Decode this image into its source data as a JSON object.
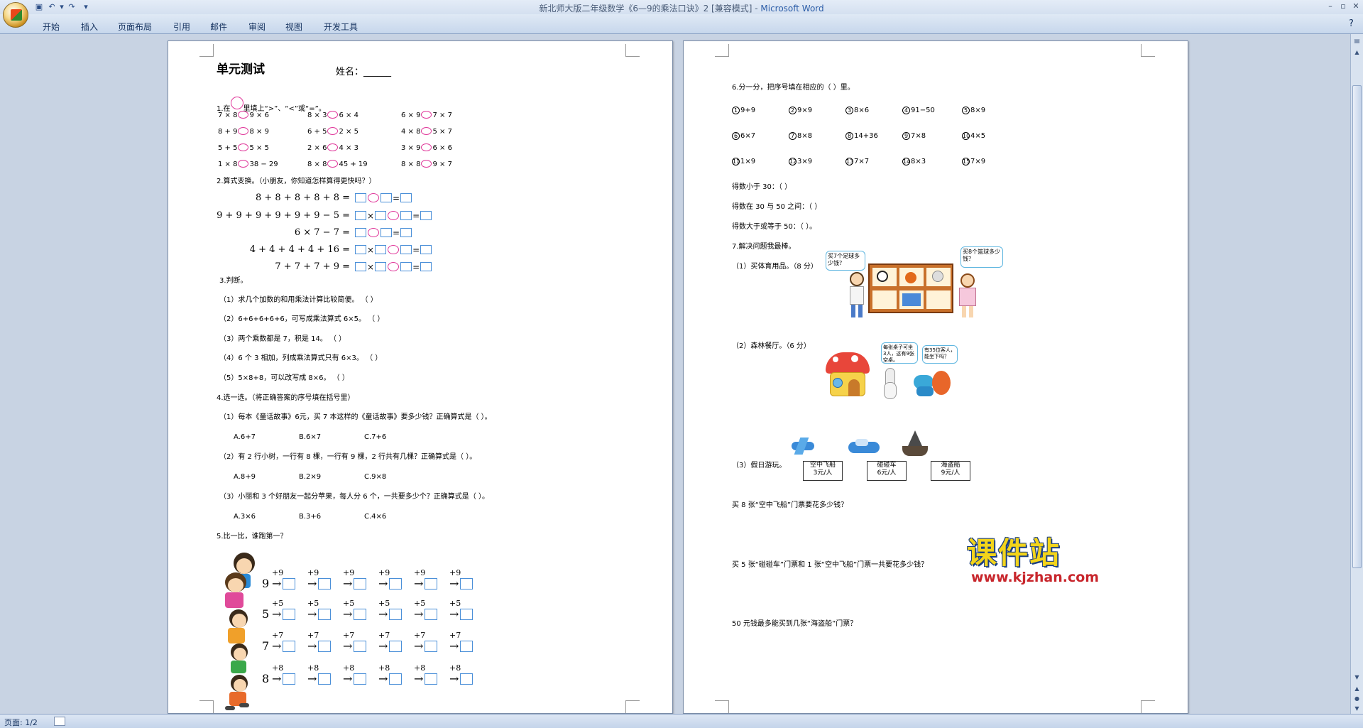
{
  "window": {
    "title_doc": "新北师大版二年级数学《6—9的乘法口诀》2 [兼容模式] - ",
    "title_app": "Microsoft Word"
  },
  "ribbon_tabs": [
    "开始",
    "插入",
    "页面布局",
    "引用",
    "邮件",
    "审阅",
    "视图",
    "开发工具"
  ],
  "status": {
    "page": "页面: 1/2"
  },
  "page1": {
    "heading": "单元测试",
    "name_label": "姓名：______",
    "q1": "1.在",
    "q1b": "里填上“>”、“<”或“=”。",
    "q1_rows": [
      [
        "7 × 8",
        "9 × 6",
        "8 × 3",
        "6 × 4",
        "6 × 9",
        "7 × 7"
      ],
      [
        "8 + 9",
        "8 × 9",
        "6 + 5",
        "2 × 5",
        "4 × 8",
        "5 × 7"
      ],
      [
        "5 + 5",
        "5 × 5",
        "2 × 6",
        "4 × 3",
        "3 × 9",
        "6 × 6"
      ],
      [
        "1 × 8",
        "38 − 29",
        "8 × 8",
        "45 + 19",
        "8 × 8",
        "9 × 7"
      ]
    ],
    "q2": "2.算式变换。（小朋友，你知道怎样算得更快吗？）",
    "q2_rows": [
      "8 + 8 + 8 + 8 + 8 =",
      "9 + 9 + 9 + 9 + 9 + 9 − 5 =",
      "6 × 7 − 7 =",
      "4 + 4 + 4 + 4 + 16 =",
      "7 + 7 + 7 + 9 ="
    ],
    "q3": "3.判断。",
    "q3_items": [
      "（1）求几个加数的和用乘法计算比较简便。      （     ）",
      "（2）6+6+6+6+6，可写成乘法算式 6×5。      （     ）",
      "（3）两个乘数都是 7，积是 14。              （     ）",
      "（4）6 个 3 相加，列成乘法算式只有 6×3。     （     ）",
      "（5）5×8+8，可以改写成 8×6。              （     ）"
    ],
    "q4": "4.选一选。（将正确答案的序号填在括号里）",
    "q4_1": "（1）每本《童话故事》6元，买 7 本这样的《童话故事》要多少钱？正确算式是（     ）。",
    "q4_1_opts": [
      "A.6+7",
      "B.6×7",
      "C.7+6"
    ],
    "q4_2": "（2）有 2 行小树，一行有 8 棵，一行有 9 棵，2 行共有几棵？正确算式是（     ）。",
    "q4_2_opts": [
      "A.8+9",
      "B.2×9",
      "C.9×8"
    ],
    "q4_3": "（3）小丽和 3 个好朋友一起分苹果，每人分 6 个，一共要多少个？正确算式是（     ）。",
    "q4_3_opts": [
      "A.3×6",
      "B.3+6",
      "C.4×6"
    ],
    "q5": "5.比一比，谁跑第一？",
    "q5_rows": [
      {
        "start": "9",
        "op": "+9"
      },
      {
        "start": "5",
        "op": "+5"
      },
      {
        "start": "7",
        "op": "+7"
      },
      {
        "start": "8",
        "op": "+8"
      }
    ]
  },
  "page2": {
    "q6": "6.分一分，把序号填在相应的（    ）里。",
    "q6_items": [
      [
        "1",
        "9+9"
      ],
      [
        "2",
        "9×9"
      ],
      [
        "3",
        "8×6"
      ],
      [
        "4",
        "91−50"
      ],
      [
        "5",
        "8×9"
      ],
      [
        "6",
        "6×7"
      ],
      [
        "7",
        "8×8"
      ],
      [
        "8",
        "14+36"
      ],
      [
        "9",
        "7×8"
      ],
      [
        "10",
        "4×5"
      ],
      [
        "11",
        "1×9"
      ],
      [
        "12",
        "3×9"
      ],
      [
        "13",
        "7×7"
      ],
      [
        "14",
        "8×3"
      ],
      [
        "15",
        "7×9"
      ]
    ],
    "q6_a": "得数小于 30：（                                  ）",
    "q6_b": "得数在 30 与 50 之间：（                            ）",
    "q6_c": "得数大于或等于 50：（                              ）。",
    "q7": "7.解决问题我最棒。",
    "q7_1": "（1）买体育用品。（8 分）",
    "bubble1": "买7个足球多少钱？",
    "bubble2": "买8个篮球多少钱？",
    "q7_2": "（2）森林餐厅。（6 分）",
    "bubble3": "每张桌子可坐3人，这有9张空桌。",
    "bubble4": "有35位客人，能坐下吗？",
    "q7_3": "（3）假日游玩。",
    "tickets": [
      [
        "空中飞船",
        "3元/人"
      ],
      [
        "碰碰车",
        "6元/人"
      ],
      [
        "海盗船",
        "9元/人"
      ]
    ],
    "q7_3a": "买 8 张“空中飞船”门票要花多少钱？",
    "q7_3b": "买 5 张“碰碰车”门票和 1 张“空中飞船”门票一共要花多少钱？",
    "q7_3c": "50 元钱最多能买到几张“海盗船”门票？"
  },
  "watermark": {
    "big": "课件站",
    "url": "www.kjzhan.com"
  }
}
